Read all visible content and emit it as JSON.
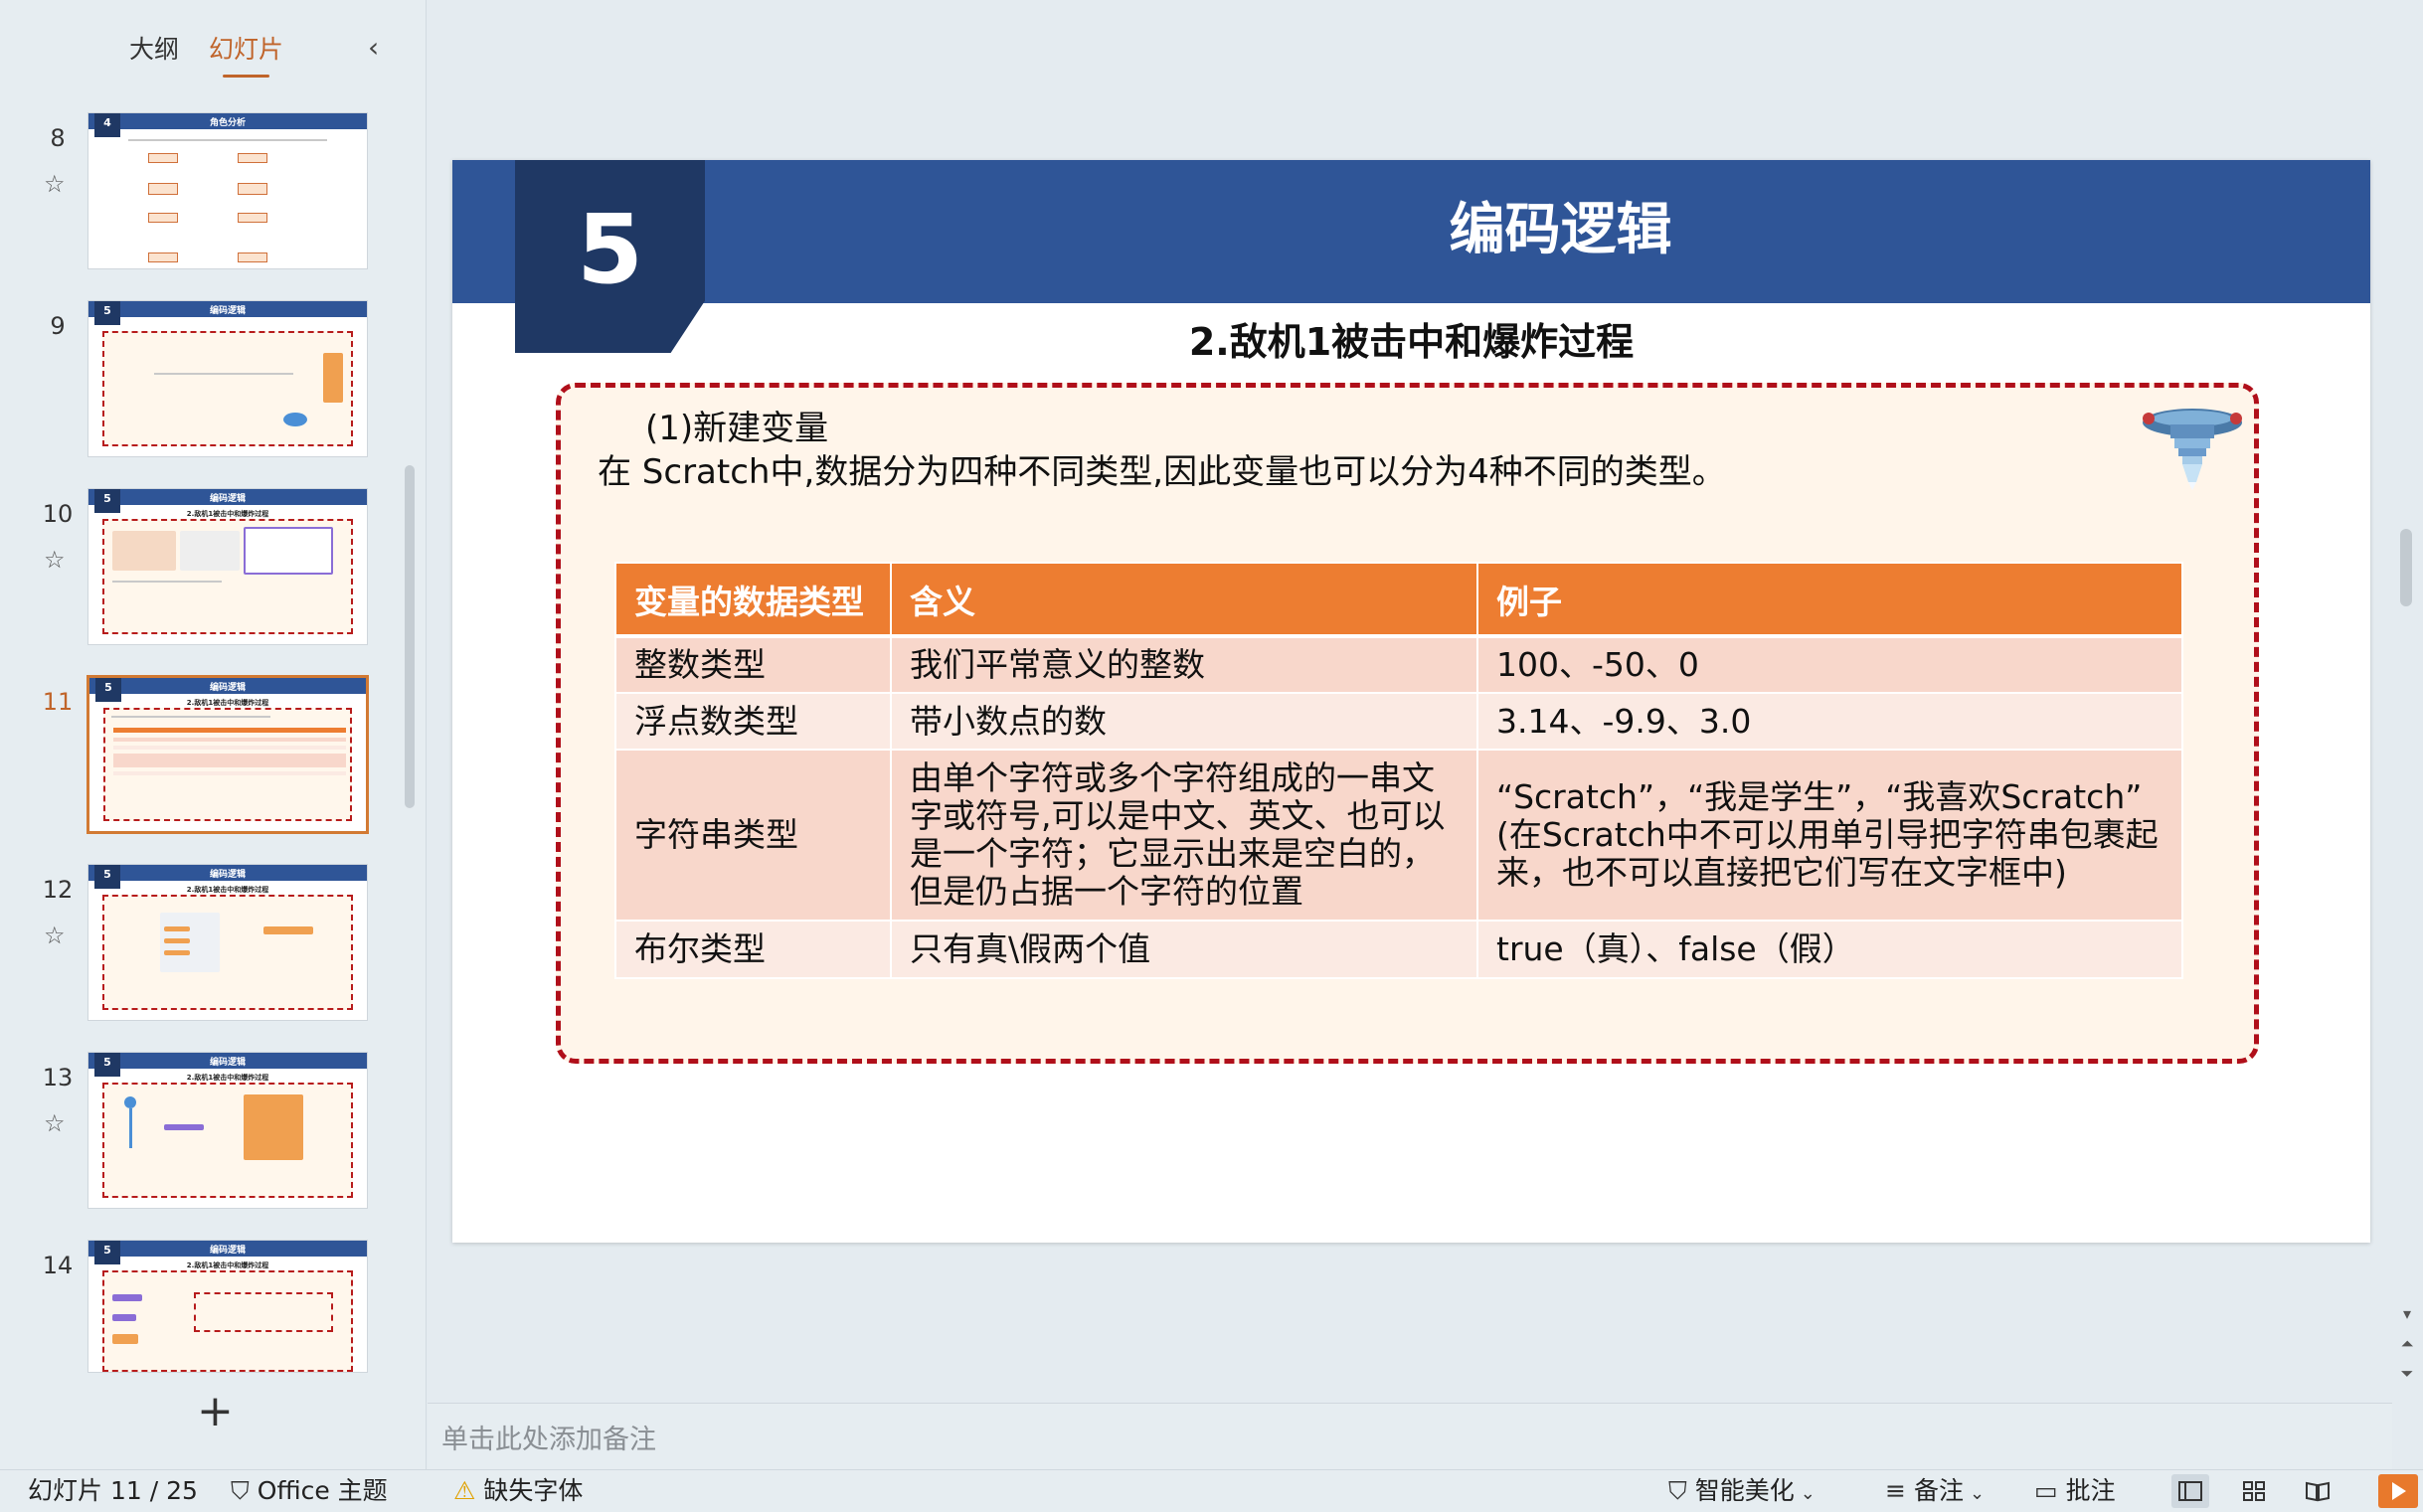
{
  "panel": {
    "tab_outline": "大纲",
    "tab_slides": "幻灯片",
    "collapse_icon": "chevron-left-icon",
    "add_icon": "plus-icon"
  },
  "thumbnails": [
    {
      "number": "8",
      "badge": "4",
      "title": "角色分析",
      "subtitle": "",
      "has_star": true
    },
    {
      "number": "9",
      "badge": "5",
      "title": "编码逻辑",
      "subtitle": "1.我方战机：角色一角...",
      "has_star": false
    },
    {
      "number": "10",
      "badge": "5",
      "title": "编码逻辑",
      "subtitle": "2.敌机1被击中和爆炸过程",
      "has_star": true
    },
    {
      "number": "11",
      "badge": "5",
      "title": "编码逻辑",
      "subtitle": "2.敌机1被击中和爆炸过程",
      "has_star": false
    },
    {
      "number": "12",
      "badge": "5",
      "title": "编码逻辑",
      "subtitle": "2.敌机1被击中和爆炸过程",
      "has_star": true
    },
    {
      "number": "13",
      "badge": "5",
      "title": "编码逻辑",
      "subtitle": "2.敌机1被击中和爆炸过程",
      "has_star": true
    },
    {
      "number": "14",
      "badge": "5",
      "title": "编码逻辑",
      "subtitle": "2.敌机1被击中和爆炸过程",
      "has_star": false
    }
  ],
  "slide": {
    "section_number": "5",
    "title": "编码逻辑",
    "subtitle": "2.敌机1被击中和爆炸过程",
    "heading": "(1)新建变量",
    "description": "在 Scratch中,数据分为四种不同类型,因此变量也可以分为4种不同的类型。",
    "table": {
      "headers": [
        "变量的数据类型",
        "含义",
        "例子"
      ],
      "rows": [
        [
          "整数类型",
          "我们平常意义的整数",
          "100、-50、0"
        ],
        [
          "浮点数类型",
          "带小数点的数",
          "3.14、-9.9、3.0"
        ],
        [
          "字符串类型",
          "由单个字符或多个字符组成的一串文字或符号,可以是中文、英文、也可以是一个字符；它显示出来是空白的，但是仍占据一个字符的位置",
          "“Scratch”，“我是学生”，“我喜欢Scratch”\n(在Scratch中不可以用单引导把字符串包裹起来，也不可以直接把它们写在文字框中)"
        ],
        [
          "布尔类型",
          "只有真\\假两个值",
          "true（真）、false（假）"
        ]
      ]
    },
    "colors": {
      "header_blue": "#2f5597",
      "badge_navy": "#1f3864",
      "table_orange": "#ed7d31",
      "dashed_red": "#b00f1a"
    }
  },
  "notes": {
    "placeholder": "单击此处添加备注"
  },
  "status": {
    "slide_counter": "幻灯片 11 / 25",
    "theme": "Office 主题",
    "missing_font": "缺失字体",
    "beautify": "智能美化",
    "notes_btn": "备注",
    "comments_btn": "批注"
  }
}
